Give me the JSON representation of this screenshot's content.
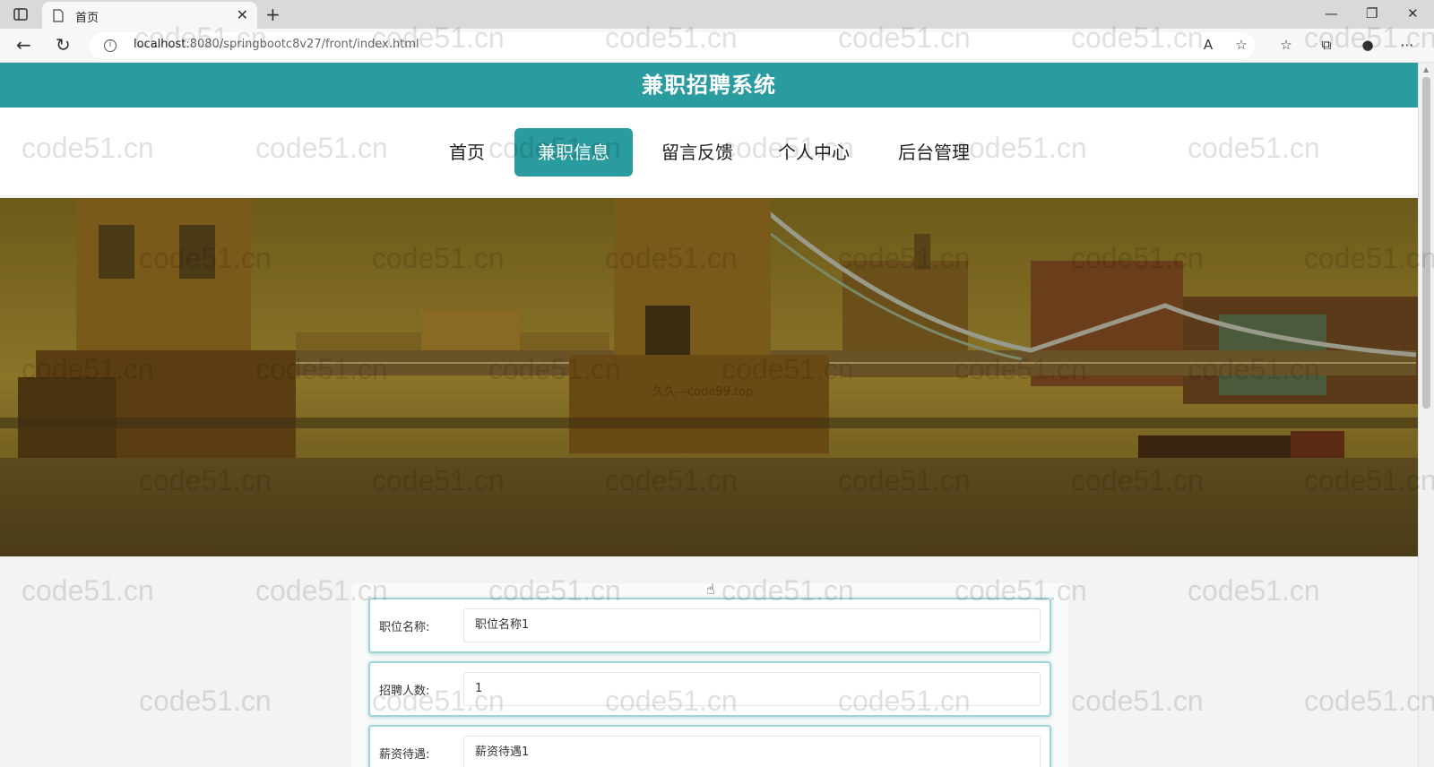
{
  "browser": {
    "tab_title": "首页",
    "url_host": "localhost",
    "url_rest": ":8080/springbootc8v27/front/index.html"
  },
  "site": {
    "title": "兼职招聘系统",
    "nav": [
      {
        "label": "首页",
        "active": false
      },
      {
        "label": "兼职信息",
        "active": true
      },
      {
        "label": "留言反馈",
        "active": false
      },
      {
        "label": "个人中心",
        "active": false
      },
      {
        "label": "后台管理",
        "active": false
      }
    ]
  },
  "banner": {
    "caption": "久久—code99.top",
    "slide_count": 3,
    "active_slide": 1
  },
  "form": {
    "fields": [
      {
        "label": "职位名称:",
        "value": "职位名称1"
      },
      {
        "label": "招聘人数:",
        "value": "1"
      },
      {
        "label": "薪资待遇:",
        "value": "薪资待遇1"
      }
    ]
  },
  "watermark_text": "code51.cn",
  "colors": {
    "accent": "#2a9b9f",
    "dot_inactive": "#d9534f"
  }
}
